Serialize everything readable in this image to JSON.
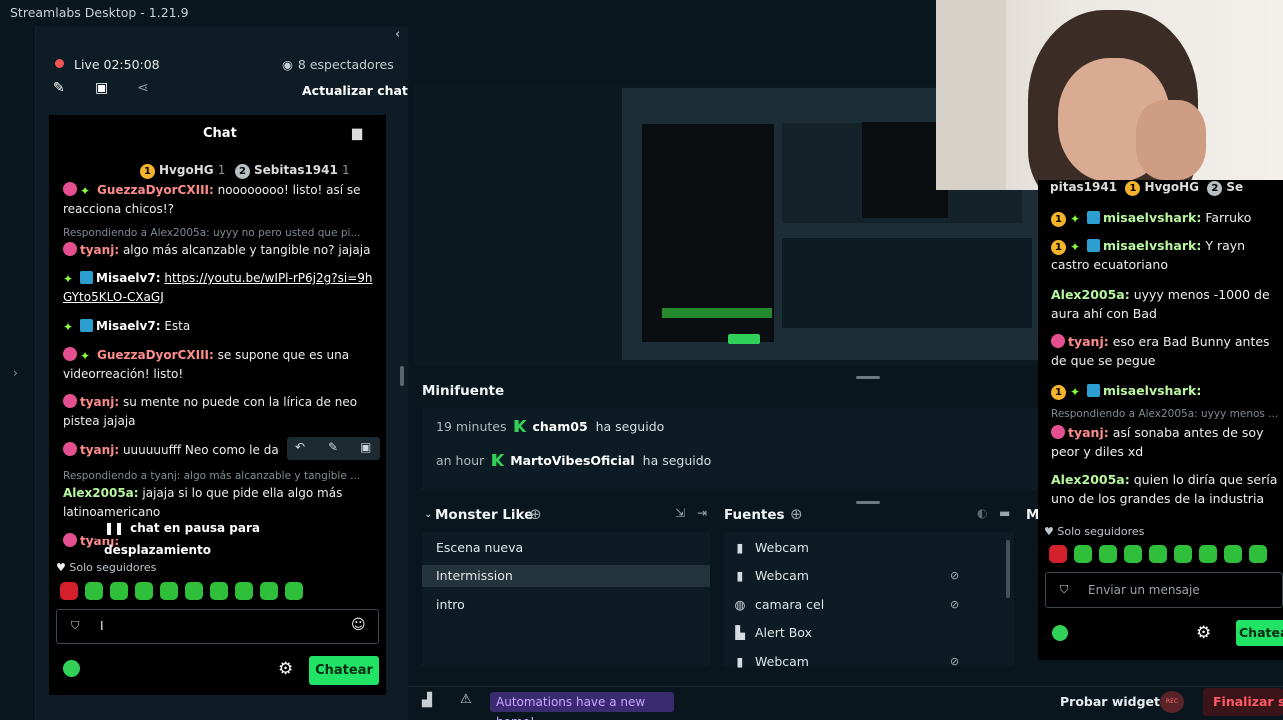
{
  "app": {
    "title": "Streamlabs Desktop - 1.21.9"
  },
  "stream": {
    "live_time": "Live 02:50:08",
    "viewers": "8 espectadores",
    "update_chat_label": "Actualizar chat"
  },
  "chat": {
    "title": "Chat",
    "top_donors": [
      {
        "rank": "1",
        "name": "HvgoHG",
        "count": "1"
      },
      {
        "rank": "2",
        "name": "Sebitas1941",
        "count": "1"
      }
    ],
    "messages": [
      {
        "user": "GuezzaDyorCXIII:",
        "text": " noooooooo! listo! así se reacciona chicos!?"
      },
      {
        "reply": "Respondiendo a Alex2005a: uyyy no pero usted que pi..."
      },
      {
        "user": "tyanj:",
        "text": " algo más alcanzable y tangible no? jajaja"
      },
      {
        "user": "Misaelv7:",
        "link": "https://youtu.be/wIPl-rP6j2g?si=9hGYto5KLO-CXaGJ"
      },
      {
        "user": "Misaelv7:",
        "text": " Esta"
      },
      {
        "user": "GuezzaDyorCXIII:",
        "text": " se supone que es una videorreación! listo!"
      },
      {
        "user": "tyanj:",
        "text": " su mente no puede con la lírica de neo pistea jajaja"
      },
      {
        "user": "tyanj:",
        "text": " uuuuuufff Neo como le da"
      },
      {
        "reply": "Respondiendo a tyanj: algo más alcanzable y tangible ..."
      },
      {
        "user": "Alex2005a:",
        "text": " jajaja si lo que pide ella algo más latinoamericano"
      },
      {
        "user": "tyanj:",
        "text": ""
      }
    ],
    "paused_label": "chat en pausa para desplazamiento",
    "followers_only": "Solo seguidores",
    "input_value": "I",
    "send_label": "Chatear"
  },
  "editor": {
    "minifuente_title": "Minifuente",
    "events": [
      {
        "time": "19 minutes",
        "user": "cham05",
        "action": "ha seguido"
      },
      {
        "time": "an hour",
        "user": "MartoVibesOficial",
        "action": "ha seguido"
      }
    ],
    "scene_collection": "Monster Like",
    "scenes": [
      "Escena nueva",
      "Intermission",
      "intro"
    ],
    "active_scene": "Intermission",
    "sources_title": "Fuentes",
    "sources": [
      {
        "icon": "webcam-icon",
        "name": "Webcam"
      },
      {
        "icon": "webcam-icon",
        "name": "Webcam"
      },
      {
        "icon": "globe-icon",
        "name": "camara cel"
      },
      {
        "icon": "alert-icon",
        "name": "Alert Box"
      },
      {
        "icon": "webcam-icon",
        "name": "Webcam"
      }
    ],
    "mixer_title_partial": "M"
  },
  "footer": {
    "automations_banner": "Automations have a new home!",
    "try_widgets": "Probar widgets",
    "rec_label": "REC",
    "end_stream": "Finalizar stre"
  },
  "right_chat": {
    "top_donors": "pitas1941",
    "top_donor_2": "HvgoHG",
    "top_donor_3": "Se",
    "messages": [
      {
        "user": "misaelvshark:",
        "text": " Farruko"
      },
      {
        "user": "misaelvshark:",
        "text": " Y rayn castro ecuatoriano"
      },
      {
        "user": "Alex2005a:",
        "text": " uyyy menos -1000 de aura ahí con Bad"
      },
      {
        "user": "tyanj:",
        "text": " eso era Bad Bunny antes de que se pegue"
      },
      {
        "user": "misaelvshark:",
        "text": ""
      },
      {
        "reply": "Respondiendo a Alex2005a: uyyy menos ..."
      },
      {
        "user": "tyanj:",
        "text": " así sonaba antes de soy peor y diles xd"
      },
      {
        "user": "Alex2005a:",
        "text": " quien lo diría que sería uno de los grandes de la industria"
      }
    ],
    "followers_only": "Solo seguidores",
    "input_placeholder": "Enviar un mensaje",
    "send_label": "Chatear"
  },
  "colors": {
    "accent": "#21e366",
    "background": "#09161d",
    "live": "#f25454",
    "banner": "#3a2a70"
  }
}
